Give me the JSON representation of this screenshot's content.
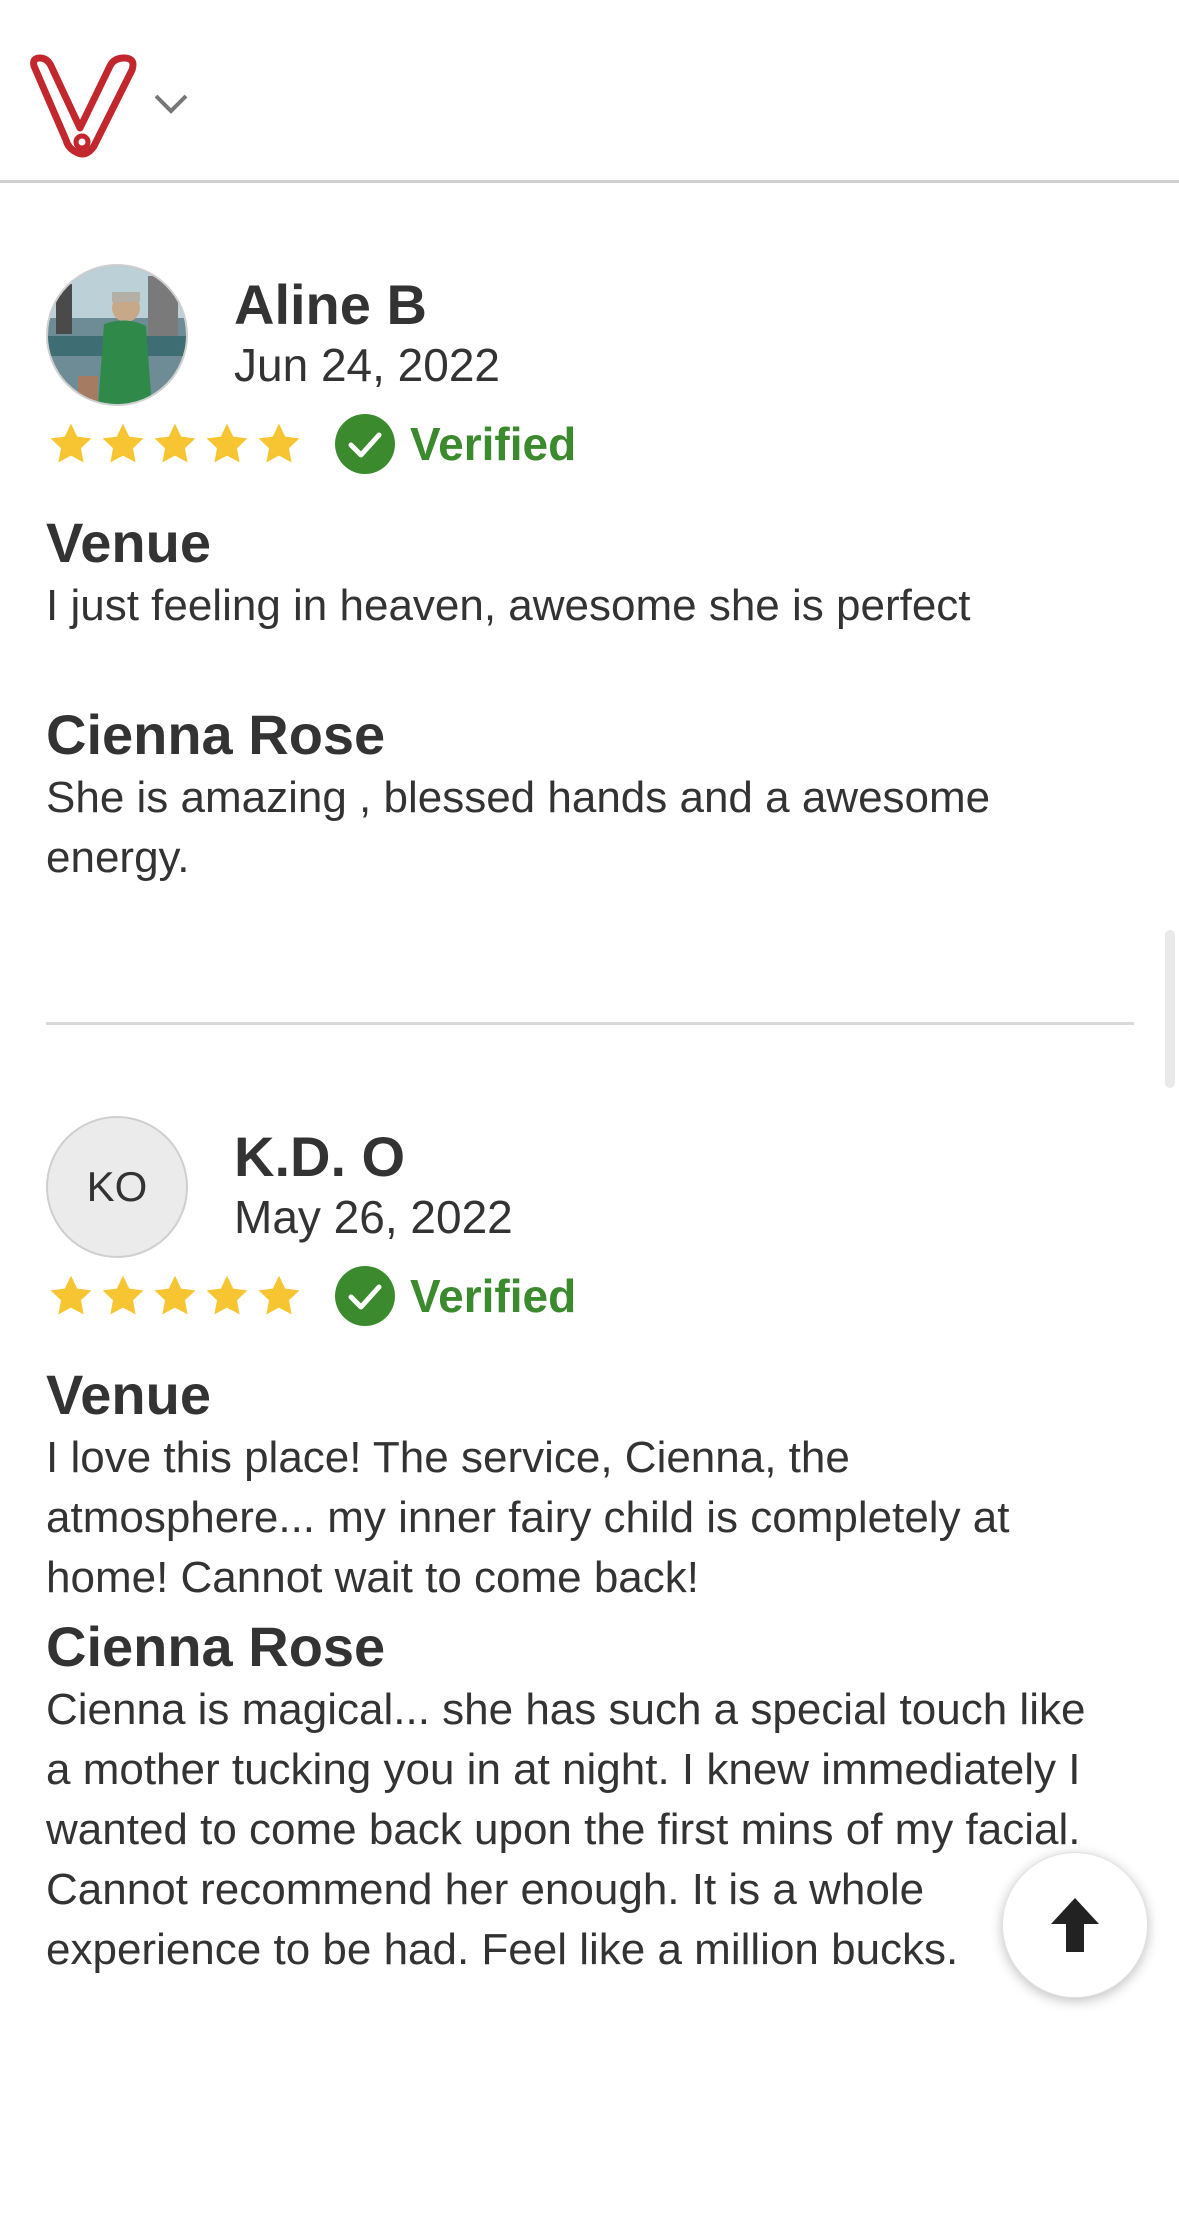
{
  "header": {
    "logo_icon": "wedding-v-logo-icon",
    "menu_icon": "chevron-down-icon"
  },
  "colors": {
    "brand": "#c1272d",
    "star": "#f7c531",
    "verified": "#3b8a2e",
    "text": "#333333"
  },
  "reviews": [
    {
      "name": "Aline B",
      "date": "Jun 24, 2022",
      "avatar": "photo",
      "rating": 5,
      "verified_label": "Verified",
      "sections": [
        {
          "title": "Venue",
          "text": "I just feeling in heaven, awesome she is perfect"
        },
        {
          "title": "Cienna Rose",
          "text": "She is amazing , blessed hands and a awesome energy."
        }
      ]
    },
    {
      "name": "K.D. O",
      "date": "May 26, 2022",
      "avatar_initials": "KO",
      "rating": 5,
      "verified_label": "Verified",
      "sections": [
        {
          "title": "Venue",
          "text": "I love this place! The service, Cienna, the atmosphere... my inner fairy child is completely at home! Cannot wait to come back!"
        },
        {
          "title": "Cienna Rose",
          "text": "Cienna is magical... she has such a special touch like a mother tucking you in at night. I knew immediately I wanted to come back upon the first mins of my facial. Cannot recommend her enough. It is a whole experience to be had. Feel like a million bucks."
        }
      ]
    }
  ],
  "scroll_top_button": {
    "icon": "arrow-up-icon"
  }
}
